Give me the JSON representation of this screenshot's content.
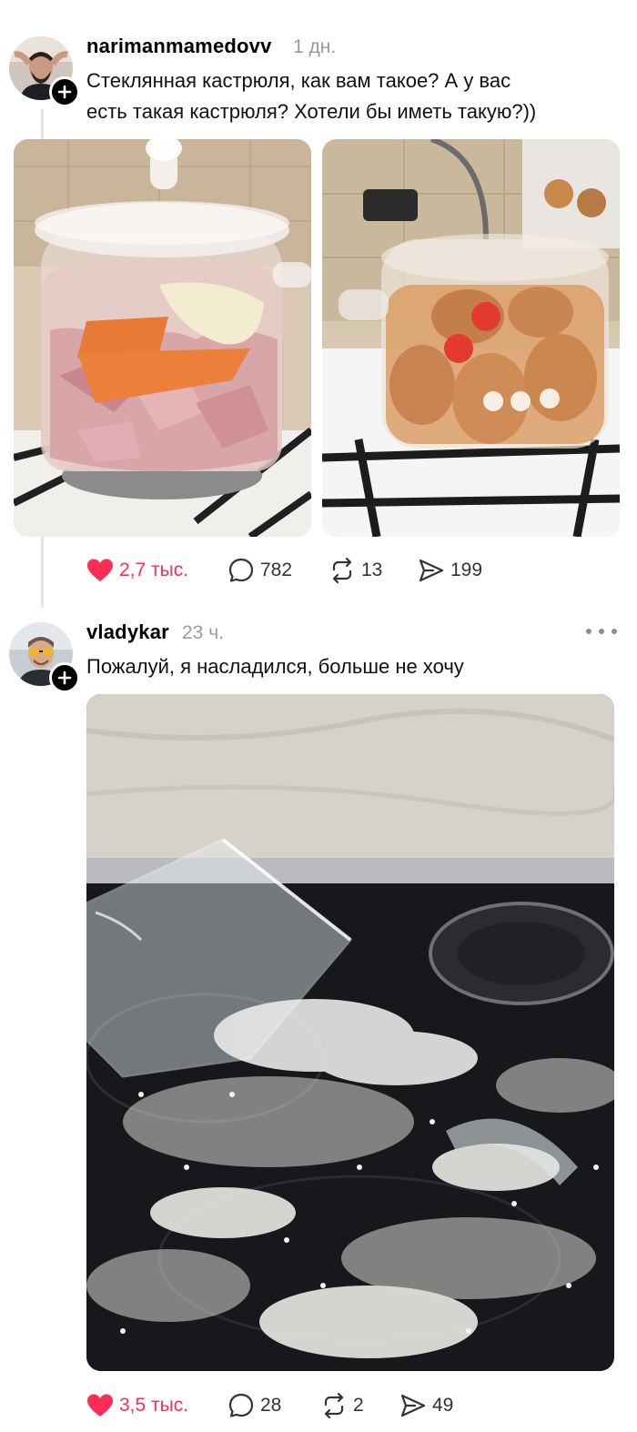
{
  "posts": [
    {
      "username": "narimanmamedovv",
      "time": "1 дн.",
      "text_line1": "Стеклянная кастрюля, как вам такое? А у вас",
      "text_line2": "есть такая кастрюля? Хотели бы иметь такую?))",
      "likes": "2,7 тыс.",
      "comments": "782",
      "reposts": "13",
      "shares": "199",
      "liked": true
    },
    {
      "username": "vladykar",
      "time": "23 ч.",
      "text_line1": "Пожалуй, я насладился, больше не хочу",
      "likes": "3,5 тыс.",
      "comments": "28",
      "reposts": "2",
      "shares": "49",
      "liked": true
    }
  ],
  "icons": {
    "like": "heart-icon",
    "comment": "comment-icon",
    "repost": "repost-icon",
    "share": "send-icon",
    "follow": "plus-icon",
    "more": "more-icon"
  },
  "colors": {
    "like_active": "#ff2d55",
    "muted": "#9a9a9a",
    "thread": "#e3e3e3"
  }
}
